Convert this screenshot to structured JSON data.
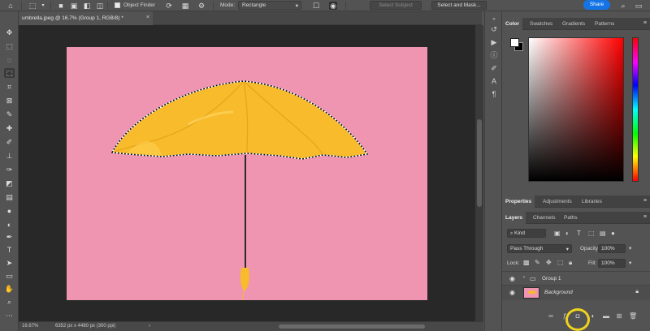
{
  "options_bar": {
    "object_finder_label": "Object Finder",
    "mode_label": "Mode:",
    "mode_value": "Rectangle",
    "select_subject_label": "Select Subject",
    "select_and_mask_label": "Select and Mask...",
    "share_label": "Share"
  },
  "document": {
    "tab_title": "umbrella.jpeg @ 16.7% (Group 1, RGB/8) *",
    "close_glyph": "×"
  },
  "status_bar": {
    "zoom": "16.67%",
    "doc_size": "6352 px x 4480 px (300 ppi)"
  },
  "color_panel": {
    "tabs": [
      "Color",
      "Swatches",
      "Gradients",
      "Patterns"
    ],
    "active_tab": "Color",
    "foreground": "#ffffff",
    "background": "#000000"
  },
  "properties_panel": {
    "tabs": [
      "Properties",
      "Adjustments",
      "Libraries"
    ]
  },
  "layers_panel": {
    "tabs": [
      "Layers",
      "Channels",
      "Paths"
    ],
    "kind_label": "Kind",
    "blend_mode": "Pass Through",
    "opacity_label": "Opacity:",
    "opacity_value": "100%",
    "lock_label": "Lock:",
    "fill_label": "Fill:",
    "fill_value": "100%",
    "layers": [
      {
        "name": "Group 1",
        "type": "group"
      },
      {
        "name": "Background",
        "type": "image",
        "locked": true
      }
    ]
  },
  "colors": {
    "canvas_pink": "#ef94b1",
    "umbrella_yellow": "#f7bb2c",
    "share_blue": "#1473e6",
    "highlight": "#f0d21c"
  }
}
